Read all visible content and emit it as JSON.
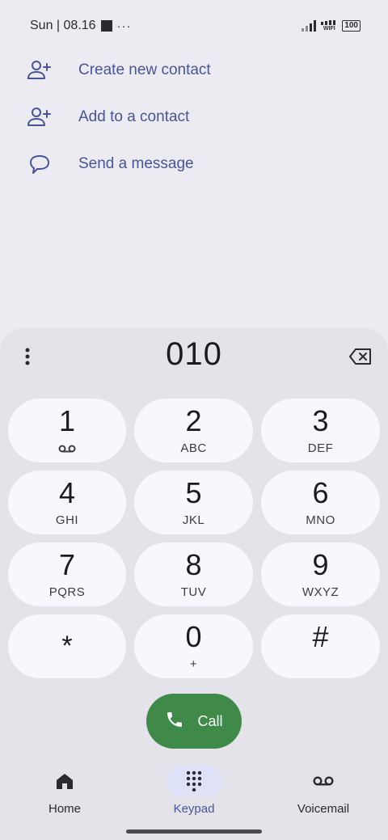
{
  "status_bar": {
    "time": "Sun | 08.16",
    "overflow": "···",
    "wifi_label": "WIFI",
    "battery": "100"
  },
  "actions": [
    {
      "label": "Create new contact",
      "icon": "add-person-icon"
    },
    {
      "label": "Add to a contact",
      "icon": "add-person-icon"
    },
    {
      "label": "Send a message",
      "icon": "message-bubble-icon"
    }
  ],
  "dialer": {
    "number": "010",
    "keys": [
      {
        "digit": "1",
        "letters": ""
      },
      {
        "digit": "2",
        "letters": "ABC"
      },
      {
        "digit": "3",
        "letters": "DEF"
      },
      {
        "digit": "4",
        "letters": "GHI"
      },
      {
        "digit": "5",
        "letters": "JKL"
      },
      {
        "digit": "6",
        "letters": "MNO"
      },
      {
        "digit": "7",
        "letters": "PQRS"
      },
      {
        "digit": "8",
        "letters": "TUV"
      },
      {
        "digit": "9",
        "letters": "WXYZ"
      },
      {
        "digit": "*",
        "letters": ""
      },
      {
        "digit": "0",
        "letters": "+"
      },
      {
        "digit": "#",
        "letters": ""
      }
    ],
    "call_label": "Call"
  },
  "bottom_nav": {
    "items": [
      {
        "label": "Home",
        "active": false
      },
      {
        "label": "Keypad",
        "active": true
      },
      {
        "label": "Voicemail",
        "active": false
      }
    ]
  },
  "colors": {
    "accent": "#46549a",
    "call_green": "#3f8a48",
    "background": "#ecebf1",
    "dialer_background": "#e4e3e9",
    "key_background": "#f8f7fb"
  }
}
